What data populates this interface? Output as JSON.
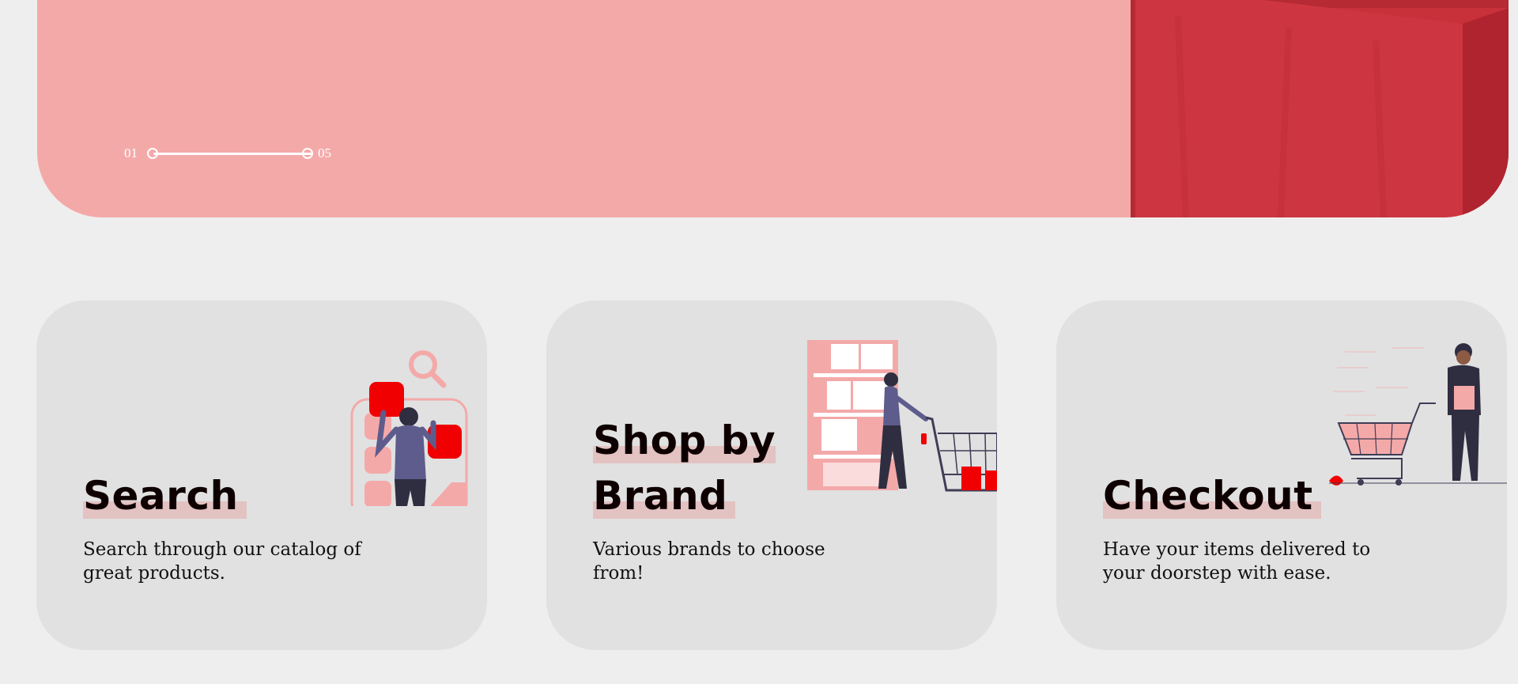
{
  "hero": {
    "slider": {
      "start_label": "01",
      "end_label": "05"
    }
  },
  "features": [
    {
      "title": "Search",
      "description": "Search through our catalog of great products.",
      "illustration": "search-illustration"
    },
    {
      "title": "Shop by Brand",
      "description": "Various brands to choose from!",
      "illustration": "shop-by-brand-illustration"
    },
    {
      "title": "Checkout",
      "description": "Have your items delivered to your doorstep with ease.",
      "illustration": "checkout-illustration"
    }
  ],
  "colors": {
    "page_background": "#eeeeee",
    "hero_background": "#f4a9a9",
    "card_background": "#e1e1e1",
    "accent_red": "#f00000",
    "figure_navy": "#2f2e41"
  }
}
